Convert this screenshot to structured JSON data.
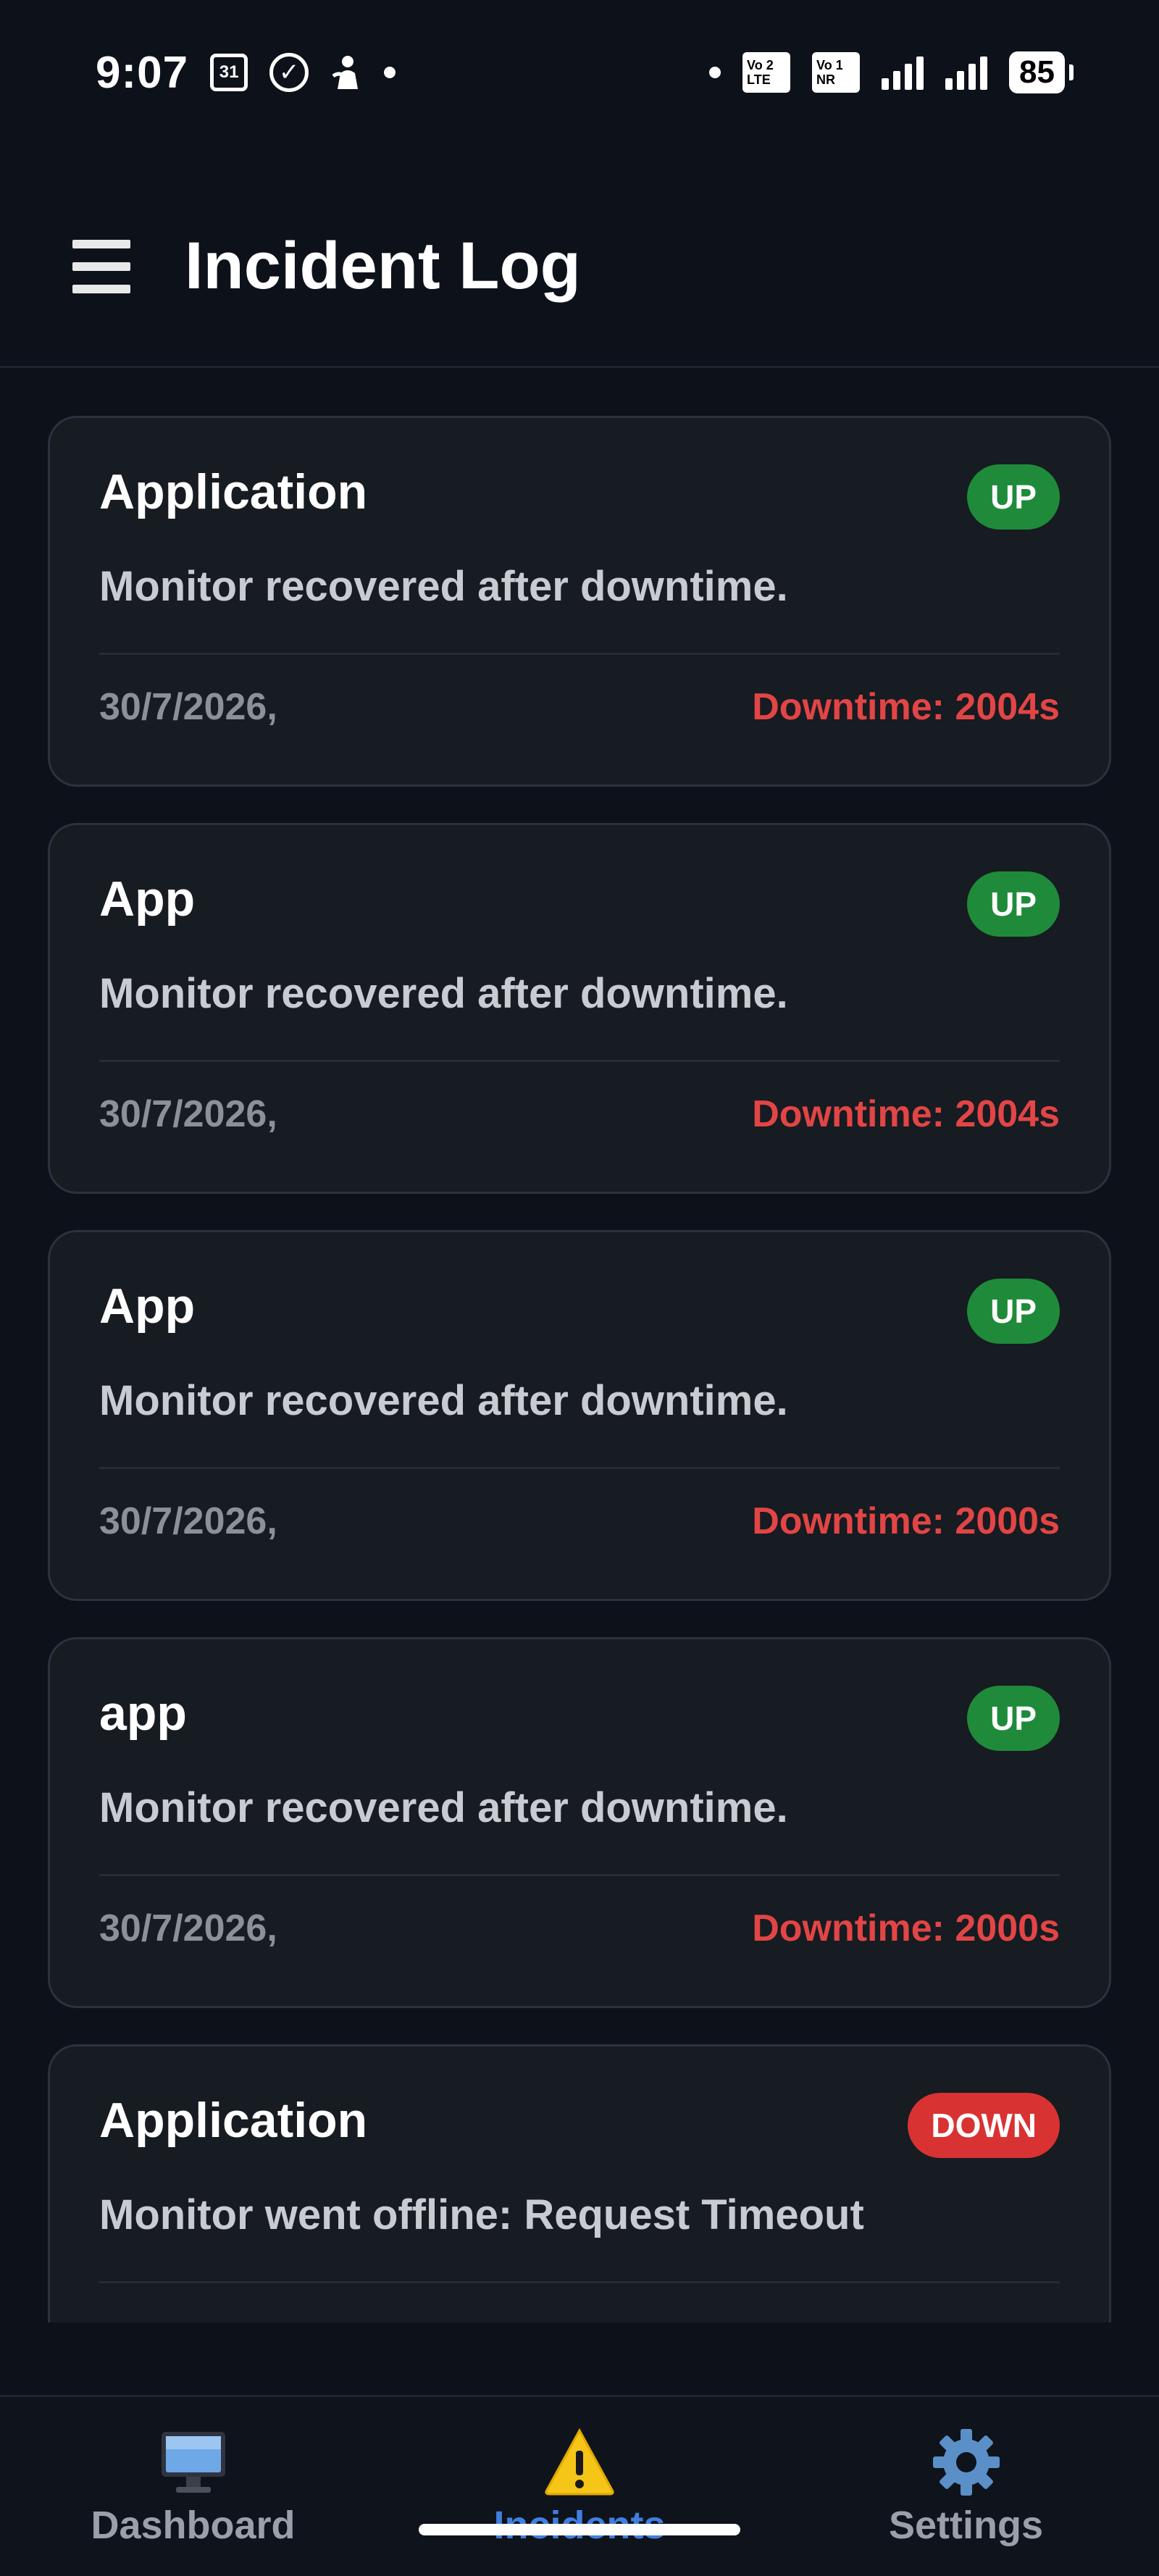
{
  "status_bar": {
    "time": "9:07",
    "calendar_day": "31",
    "volte_1": {
      "top": "Vo 2",
      "bottom": "LTE"
    },
    "volte_2": {
      "top": "Vo 1",
      "bottom": "NR"
    },
    "battery": "85"
  },
  "header": {
    "title": "Incident Log"
  },
  "incidents": [
    {
      "monitor": "Application",
      "status": "UP",
      "message": "Monitor recovered after downtime.",
      "date": "30/7/2026,",
      "downtime": "Downtime: 2004s"
    },
    {
      "monitor": "App",
      "status": "UP",
      "message": "Monitor recovered after downtime.",
      "date": "30/7/2026,",
      "downtime": "Downtime: 2004s"
    },
    {
      "monitor": "App",
      "status": "UP",
      "message": "Monitor recovered after downtime.",
      "date": "30/7/2026,",
      "downtime": "Downtime: 2000s"
    },
    {
      "monitor": "app",
      "status": "UP",
      "message": "Monitor recovered after downtime.",
      "date": "30/7/2026,",
      "downtime": "Downtime: 2000s"
    },
    {
      "monitor": "Application",
      "status": "DOWN",
      "message": "Monitor went offline: Request Timeout",
      "date": "",
      "downtime": ""
    }
  ],
  "nav": {
    "items": [
      {
        "label": "Dashboard",
        "icon": "monitor-icon"
      },
      {
        "label": "Incidents",
        "icon": "warning-icon",
        "active": true
      },
      {
        "label": "Settings",
        "icon": "gear-icon"
      }
    ]
  },
  "colors": {
    "background": "#0d111a",
    "card": "#171b22",
    "status_up": "#1f8b3a",
    "status_down": "#d93232",
    "downtime_text": "#e24545",
    "active_nav": "#3f7fe0"
  }
}
